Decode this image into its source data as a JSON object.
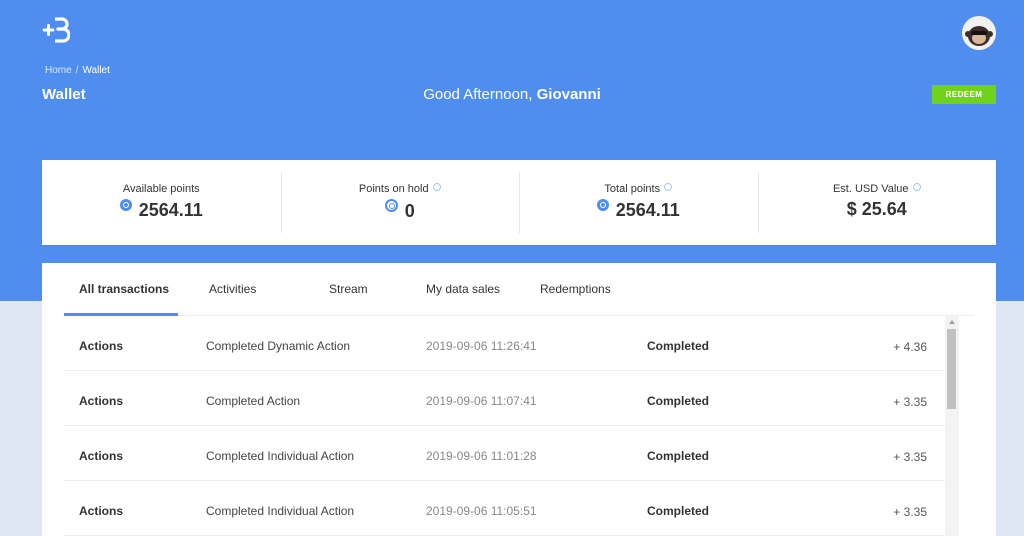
{
  "header": {
    "breadcrumb": {
      "home": "Home",
      "separator": "/",
      "current": "Wallet"
    },
    "title": "Wallet",
    "greeting_prefix": "Good Afternoon,",
    "user_name": "Giovanni",
    "redeem_label": "REDEEM",
    "accent_color": "#4f8eef",
    "redeem_color": "#6fd21d"
  },
  "stats": [
    {
      "label": "Available points",
      "value": "2564.11",
      "icon": "coin-icon"
    },
    {
      "label": "Points on hold",
      "value": "0",
      "icon": "coin-ring-icon"
    },
    {
      "label": "Total points",
      "value": "2564.11",
      "icon": "coin-icon"
    },
    {
      "label": "Est. USD Value",
      "value": "$ 25.64"
    }
  ],
  "tabs": [
    "All transactions",
    "Activities",
    "Stream",
    "My data sales",
    "Redemptions"
  ],
  "transactions": [
    {
      "type": "Actions",
      "description": "Completed Dynamic Action",
      "date": "2019-09-06 11:26:41",
      "status": "Completed",
      "amount": "+ 4.36"
    },
    {
      "type": "Actions",
      "description": "Completed Action",
      "date": "2019-09-06 11:07:41",
      "status": "Completed",
      "amount": "+ 3.35"
    },
    {
      "type": "Actions",
      "description": "Completed Individual Action",
      "date": "2019-09-06 11:01:28",
      "status": "Completed",
      "amount": "+ 3.35"
    },
    {
      "type": "Actions",
      "description": "Completed Individual Action",
      "date": "2019-09-06 11:05:51",
      "status": "Completed",
      "amount": "+ 3.35"
    }
  ]
}
